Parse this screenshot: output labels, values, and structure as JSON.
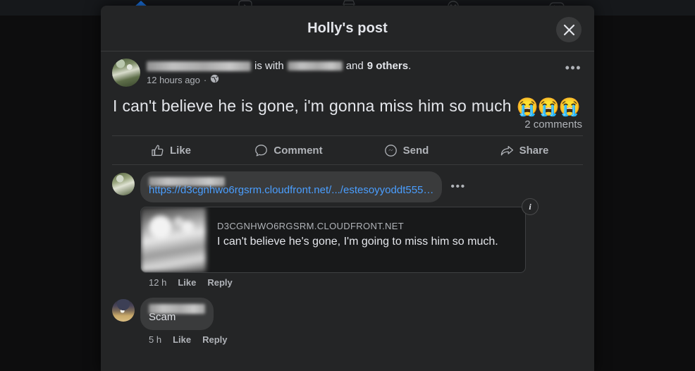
{
  "topnav": {
    "icons": [
      "home-icon",
      "video-icon",
      "marketplace-icon",
      "groups-icon",
      "gaming-icon"
    ]
  },
  "modal": {
    "title": "Holly's post",
    "close_label": "×"
  },
  "post": {
    "author_name_redacted": true,
    "is_with_label": "is with",
    "and_label": "and",
    "others_count": "9 others",
    "others_suffix": ".",
    "timestamp": "12 hours ago",
    "privacy_icon": "globe-icon",
    "menu_label": "•••",
    "text": "I can't believe he is gone, i'm gonna miss him so much",
    "emojis": "😭😭😭",
    "comments_count": "2 comments"
  },
  "actions": [
    {
      "label": "Like",
      "icon": "thumbs-up-icon"
    },
    {
      "label": "Comment",
      "icon": "comment-bubble-icon"
    },
    {
      "label": "Send",
      "icon": "messenger-icon"
    },
    {
      "label": "Share",
      "icon": "share-arrow-icon"
    }
  ],
  "comments": [
    {
      "author_redacted": true,
      "link_text": "https://d3cgnhwo6rgsrm.cloudfront.net/.../estesoyyoddt555…",
      "menu_label": "•••",
      "preview": {
        "domain": "D3CGNHWO6RGSRM.CLOUDFRONT.NET",
        "title": "I can't believe he's gone, I'm going to miss him so much.",
        "info_badge": "i"
      },
      "time": "12 h",
      "like_label": "Like",
      "reply_label": "Reply"
    },
    {
      "author_redacted": true,
      "text": "Scam",
      "time": "5 h",
      "like_label": "Like",
      "reply_label": "Reply"
    }
  ],
  "colors": {
    "modal_bg": "#242526",
    "page_bg": "#0d0d0e",
    "bubble": "#3a3b3c",
    "link_blue": "#4a9eff",
    "text_primary": "#e4e6eb",
    "text_secondary": "#b0b3b8"
  }
}
